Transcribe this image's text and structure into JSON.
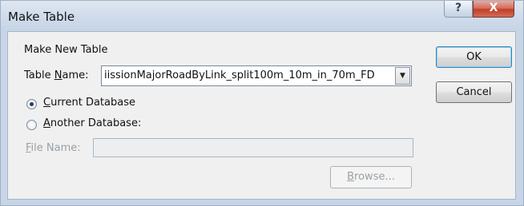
{
  "window": {
    "title": "Make Table",
    "help_glyph": "?",
    "close_glyph": "X"
  },
  "form": {
    "section_label": "Make New Table",
    "table_name_label_pre": "Table ",
    "table_name_label_accel": "N",
    "table_name_label_post": "ame:",
    "table_name_value": "iissionMajorRoadByLink_split100m_10m_in_70m_FD",
    "combo_arrow_glyph": "▼",
    "current_db_accel": "C",
    "current_db_rest": "urrent Database",
    "current_db_selected": true,
    "another_db_accel": "A",
    "another_db_rest": "nother Database:",
    "another_db_selected": false,
    "file_name_accel": "F",
    "file_name_rest": "ile Name:",
    "file_name_value": ""
  },
  "buttons": {
    "ok": "OK",
    "cancel": "Cancel",
    "browse_accel": "B",
    "browse_rest": "rowse..."
  }
}
